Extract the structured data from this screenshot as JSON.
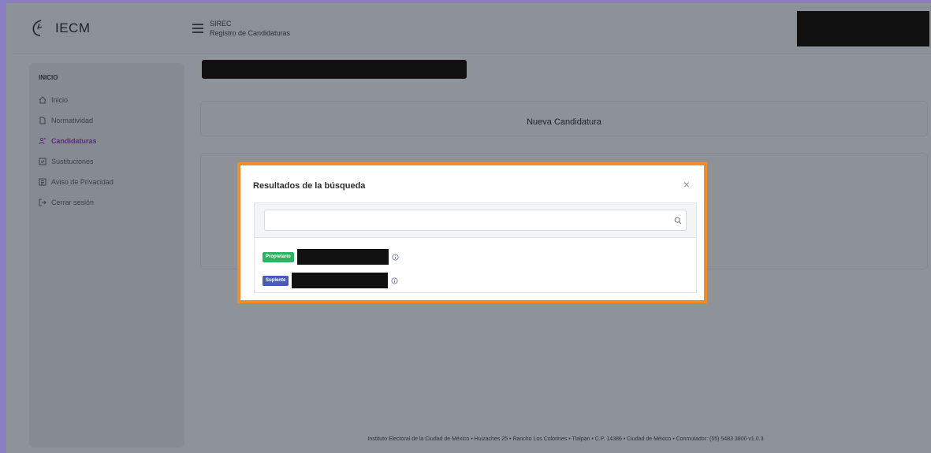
{
  "header": {
    "logo_text": "IECM",
    "app_short": "SIREC",
    "app_subtitle": "Registro de Candidaturas"
  },
  "sidebar": {
    "heading": "INICIO",
    "items": [
      {
        "label": "Inicio",
        "icon": "home-icon"
      },
      {
        "label": "Normatividad",
        "icon": "document-icon"
      },
      {
        "label": "Candidaturas",
        "icon": "users-icon",
        "active": true
      },
      {
        "label": "Sustituciones",
        "icon": "check-square-icon"
      },
      {
        "label": "Aviso de Privacidad",
        "icon": "document-list-icon"
      },
      {
        "label": "Cerrar sesión",
        "icon": "logout-icon"
      }
    ]
  },
  "main": {
    "card_title": "Nueva Candidatura"
  },
  "modal": {
    "title": "Resultados de la búsqueda",
    "close_symbol": "×",
    "search_value": "",
    "search_placeholder": "",
    "results": [
      {
        "badge": "Propietario",
        "color": "#2db361"
      },
      {
        "badge": "Suplente",
        "color": "#4a5bb5"
      }
    ]
  },
  "footer": {
    "text": "Instituto Electoral de la Ciudad de México • Huizaches 25 • Rancho Los Colorines • Tlalpan • C.P. 14386 • Ciudad de México • Conmutador: (55) 5483 3800 v1.0.3"
  },
  "colors": {
    "frame": "#8b7fc3",
    "highlight": "#f28c28",
    "overlay": "#8e9299"
  }
}
